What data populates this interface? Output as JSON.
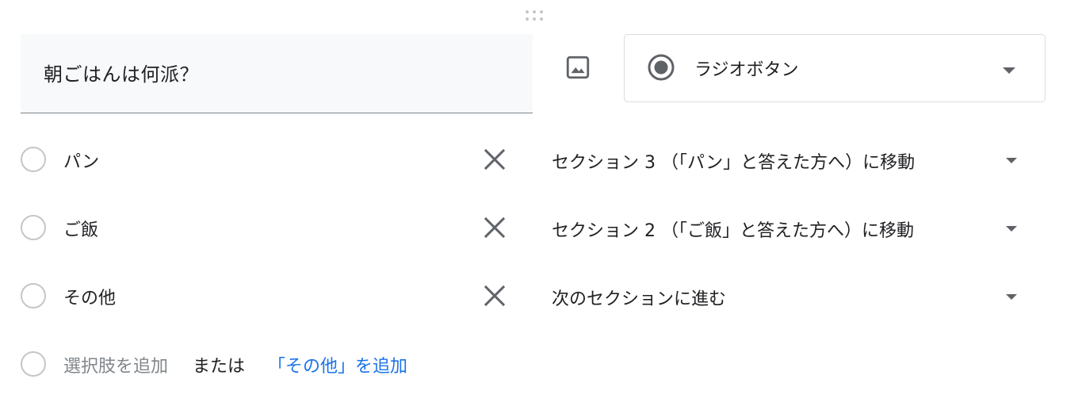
{
  "question": {
    "title": "朝ごはんは何派？"
  },
  "toolbar": {
    "image_icon": "image-icon",
    "type_select": {
      "icon": "radio-checked-icon",
      "value": "ラジオボタン"
    }
  },
  "options": [
    {
      "label": "パン",
      "goto": "セクション 3 （「パン」と答えた方へ）に移動"
    },
    {
      "label": "ご飯",
      "goto": "セクション 2 （「ご飯」と答えた方へ）に移動"
    },
    {
      "label": "その他",
      "goto": "次のセクションに進む"
    }
  ],
  "add_option": {
    "placeholder": "選択肢を追加",
    "or_text": "または",
    "add_other_link": "「その他」を追加"
  },
  "colors": {
    "field_background": "#f8f9fa",
    "link": "#1a73e8",
    "icon": "#5f6368",
    "radio_border": "#c4c7c5"
  }
}
